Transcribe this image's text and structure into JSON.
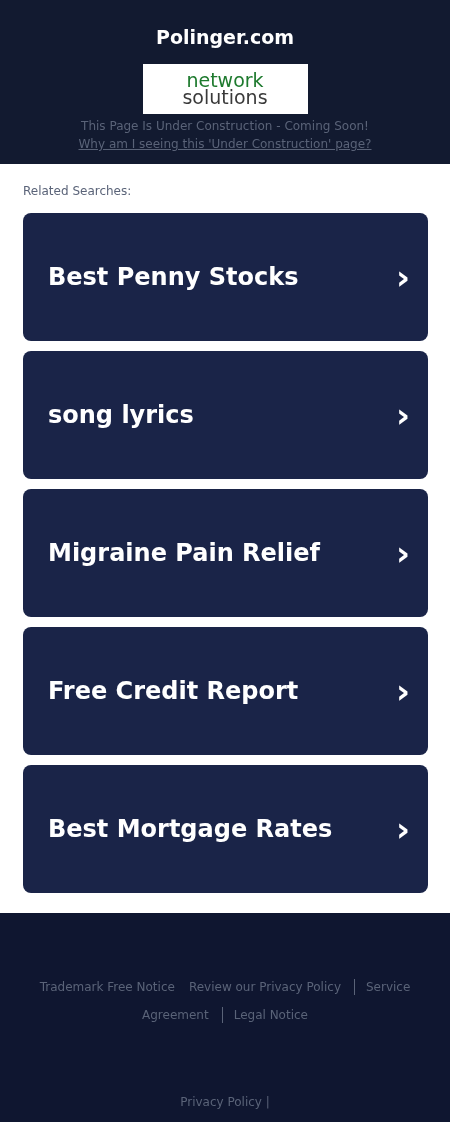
{
  "header": {
    "domain": "Polinger.com",
    "logo": {
      "line_1": "network",
      "line_2": "solutions"
    },
    "notice": "This Page Is Under Construction - Coming Soon!",
    "why_link": "Why am I seeing this 'Under Construction' page?"
  },
  "related": {
    "heading": "Related Searches:",
    "links": [
      {
        "label": "Best Penny Stocks",
        "icon": "›"
      },
      {
        "label": "song lyrics",
        "icon": "›"
      },
      {
        "label": "Migraine Pain Relief",
        "icon": "›"
      },
      {
        "label": "Free Credit Report",
        "icon": "›"
      },
      {
        "label": "Best Mortgage Rates",
        "icon": "›"
      }
    ]
  },
  "footer": {
    "link_rows": [
      [
        {
          "label": "Trademark Free Notice",
          "divider_before": false
        },
        {
          "label": "Review our Privacy Policy",
          "divider_before": false
        },
        {
          "label": "Service",
          "divider_before": true
        }
      ],
      [
        {
          "label": "Agreement",
          "divider_before": false
        },
        {
          "label": "Legal Notice",
          "divider_before": true
        }
      ]
    ],
    "bottom": "Privacy Policy |"
  }
}
